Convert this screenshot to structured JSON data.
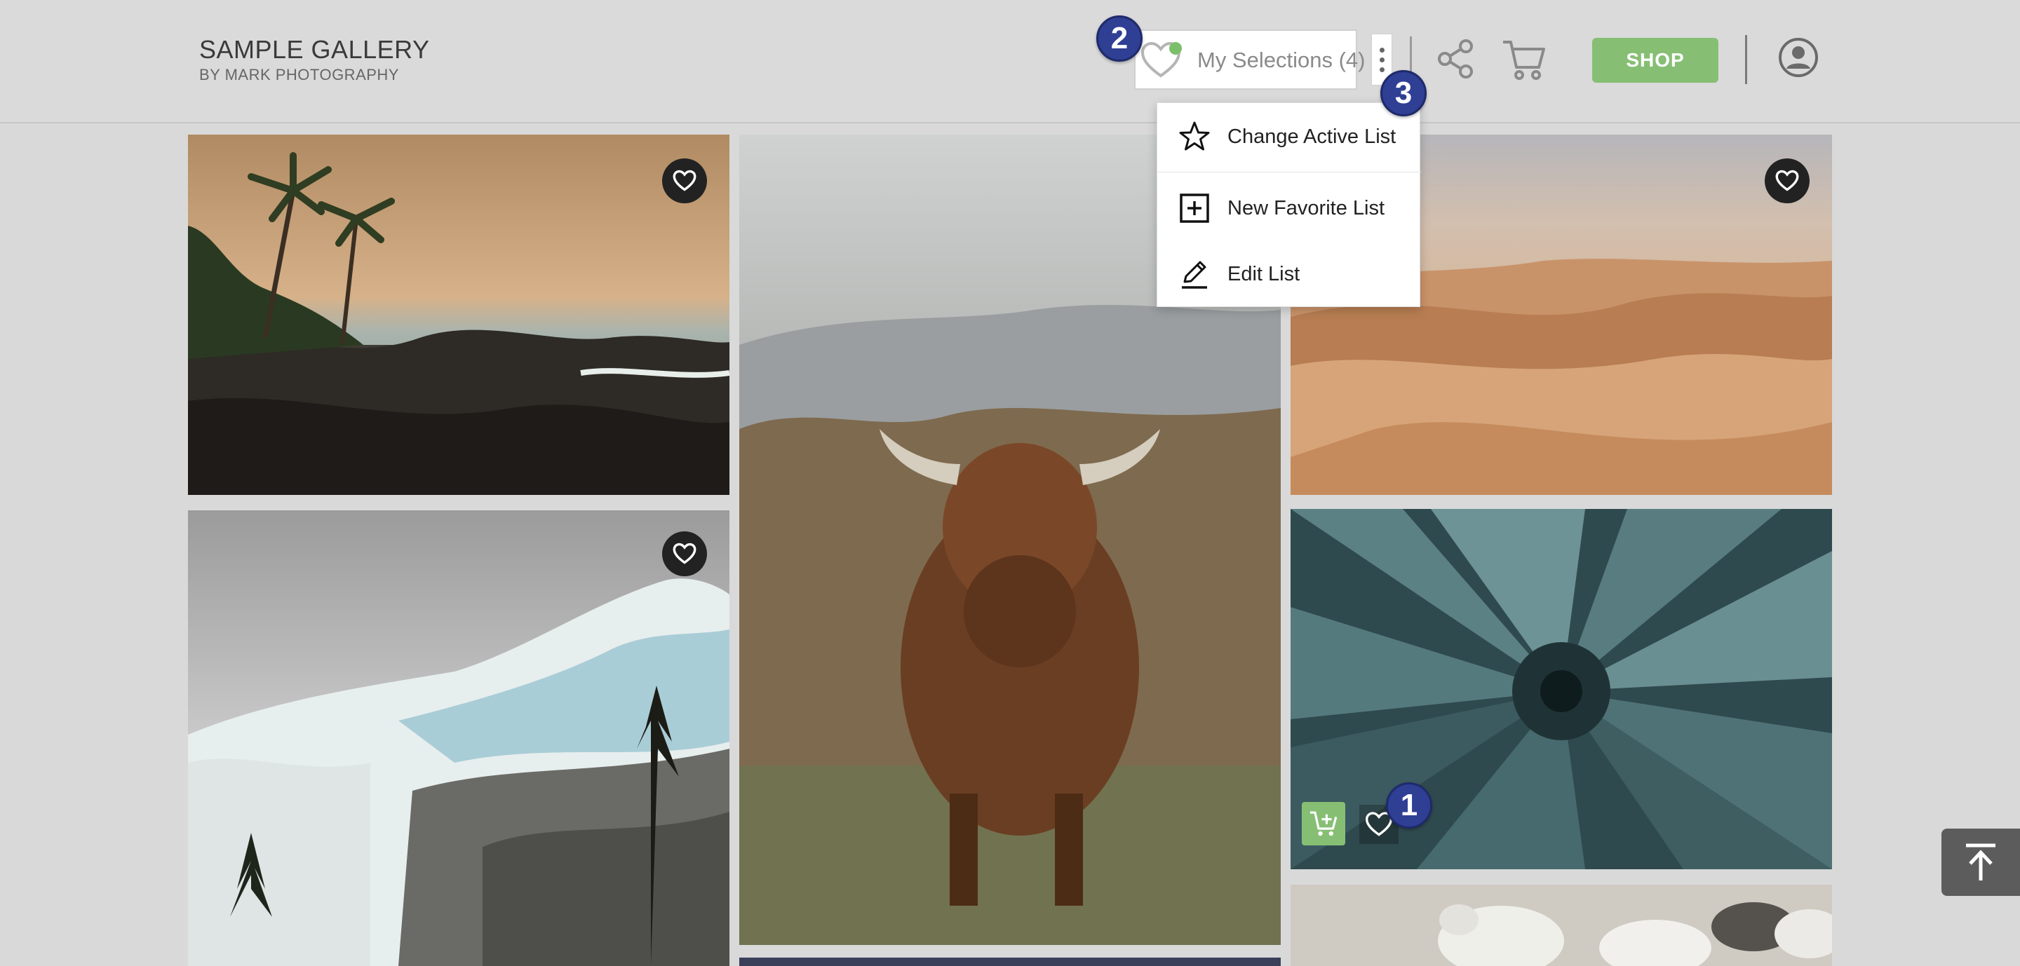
{
  "header": {
    "brand_title": "SAMPLE GALLERY",
    "brand_subtitle": "BY MARK PHOTOGRAPHY",
    "selections_label": "My Selections (4)",
    "shop_label": "SHOP"
  },
  "dropdown": {
    "items": [
      {
        "label": "Change Active List",
        "icon": "star-icon"
      },
      {
        "label": "New Favorite List",
        "icon": "plus-square-icon"
      },
      {
        "label": "Edit List",
        "icon": "pencil-icon"
      }
    ]
  },
  "badges": {
    "one": "1",
    "two": "2",
    "three": "3"
  },
  "photos": [
    {
      "name": "beach-palms",
      "favorite_button": true
    },
    {
      "name": "highland-cow",
      "favorite_button": false
    },
    {
      "name": "desert-dunes",
      "favorite_button": true
    },
    {
      "name": "glacier-mountain",
      "favorite_button": true
    },
    {
      "name": "agave-succulent",
      "favorite_button": false
    },
    {
      "name": "sheep",
      "favorite_button": false
    }
  ],
  "colors": {
    "accent_green": "#86bf74",
    "badge_blue": "#2f3f94",
    "online_dot": "#7cbf6b"
  }
}
